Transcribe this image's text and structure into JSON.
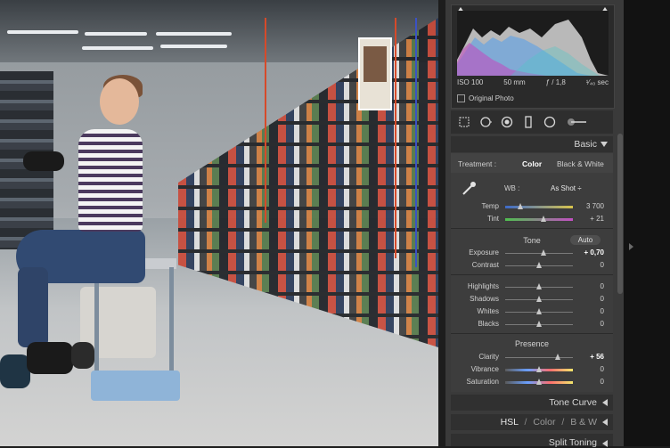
{
  "histogram": {
    "iso": "ISO 100",
    "focal_length": "50 mm",
    "aperture": "ƒ / 1,8",
    "shutter": "¹⁄₄₀ sec",
    "original_photo_label": "Original Photo"
  },
  "tools": [
    "crop-overlay-icon",
    "spot-removal-icon",
    "red-eye-icon",
    "graduated-filter-icon",
    "radial-filter-icon",
    "adjustment-brush-icon"
  ],
  "basic": {
    "section_title": "Basic",
    "treatment_label": "Treatment :",
    "treatment_color": "Color",
    "treatment_bw": "Black & White",
    "wb_label": "WB :",
    "wb_value": "As Shot ÷",
    "temp": {
      "label": "Temp",
      "value": "3 700",
      "level": 0.25
    },
    "tint": {
      "label": "Tint",
      "value": "+ 21",
      "level": 0.58
    },
    "tone_label": "Tone",
    "auto_label": "Auto",
    "exposure": {
      "label": "Exposure",
      "value": "+ 0,70",
      "level": 0.57
    },
    "contrast": {
      "label": "Contrast",
      "value": "0",
      "level": 0.5
    },
    "highlights": {
      "label": "Highlights",
      "value": "0",
      "level": 0.5
    },
    "shadows": {
      "label": "Shadows",
      "value": "0",
      "level": 0.5
    },
    "whites": {
      "label": "Whites",
      "value": "0",
      "level": 0.5
    },
    "blacks": {
      "label": "Blacks",
      "value": "0",
      "level": 0.5
    },
    "presence_label": "Presence",
    "clarity": {
      "label": "Clarity",
      "value": "+ 56",
      "level": 0.78
    },
    "vibrance": {
      "label": "Vibrance",
      "value": "0",
      "level": 0.5
    },
    "saturation": {
      "label": "Saturation",
      "value": "0",
      "level": 0.5
    }
  },
  "panels": {
    "tone_curve": "Tone Curve",
    "hsl": "HSL",
    "hsl_sep1": "/",
    "color": "Color",
    "hsl_sep2": "/",
    "bw": "B & W",
    "split_toning": "Split Toning"
  },
  "colors": {
    "panel_bg": "#3a3a3a",
    "accent_text": "#d6d6d6"
  }
}
